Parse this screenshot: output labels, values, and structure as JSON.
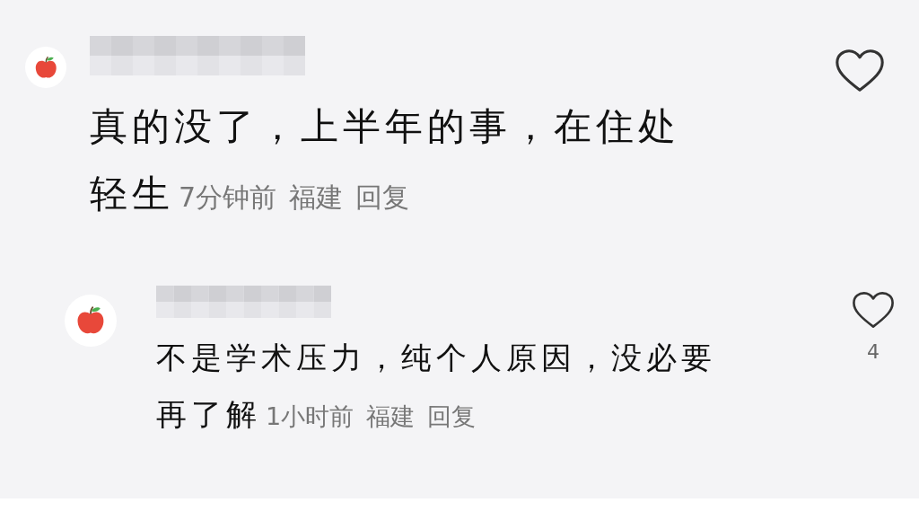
{
  "comments": [
    {
      "kind": "comment",
      "lines": [
        "真的没了，上半年的事，在住处",
        "轻生"
      ],
      "time": "7分钟前",
      "location": "福建",
      "reply": "回复"
    },
    {
      "kind": "reply",
      "lines": [
        "不是学术压力，纯个人原因，没必要",
        "再了解"
      ],
      "time": "1小时前",
      "location": "福建",
      "reply": "回复",
      "likes": "4"
    }
  ]
}
